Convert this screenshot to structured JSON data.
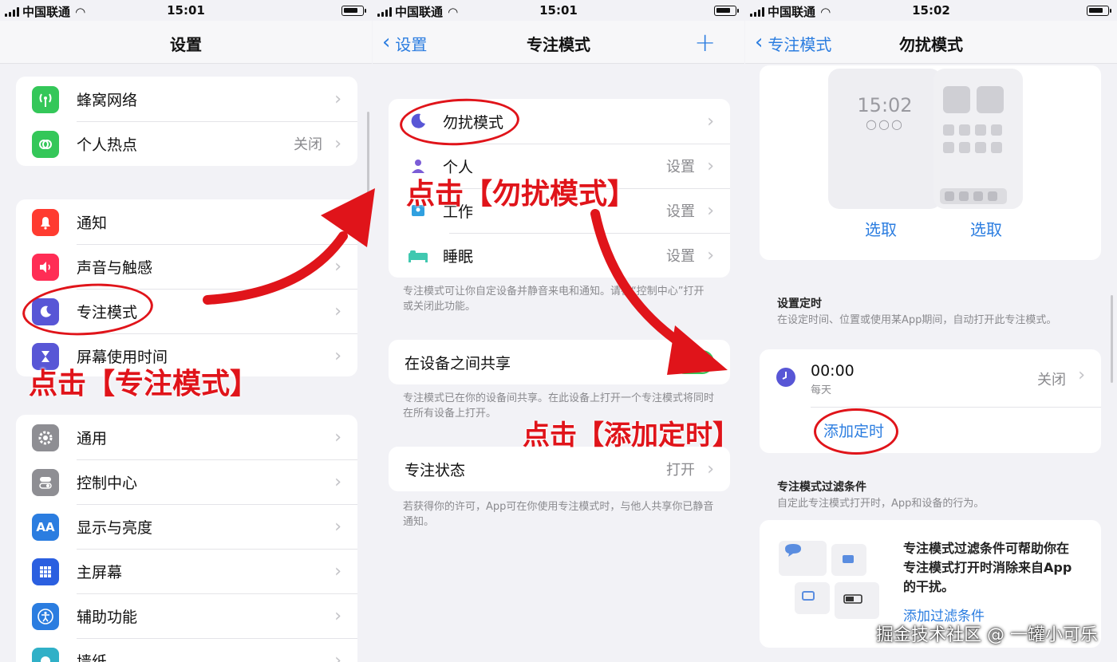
{
  "status_bars": [
    {
      "carrier": "中国联通",
      "time": "15:01"
    },
    {
      "carrier": "中国联通",
      "time": "15:01"
    },
    {
      "carrier": "中国联通",
      "time": "15:02"
    }
  ],
  "screen1": {
    "title": "设置",
    "group1": [
      {
        "label": "蜂窝网络",
        "value": "",
        "icon": "antenna-icon",
        "color": "#34c759"
      },
      {
        "label": "个人热点",
        "value": "关闭",
        "icon": "hotspot-icon",
        "color": "#34c759"
      }
    ],
    "group2": [
      {
        "label": "通知",
        "icon": "bell-icon",
        "color": "#ff3b30"
      },
      {
        "label": "声音与触感",
        "icon": "speaker-icon",
        "color": "#ff2d55"
      },
      {
        "label": "专注模式",
        "icon": "moon-icon",
        "color": "#5856d6"
      },
      {
        "label": "屏幕使用时间",
        "icon": "hourglass-icon",
        "color": "#5856d6"
      }
    ],
    "group3": [
      {
        "label": "通用",
        "icon": "gear-icon",
        "color": "#8e8e93"
      },
      {
        "label": "控制中心",
        "icon": "toggles-icon",
        "color": "#8e8e93"
      },
      {
        "label": "显示与亮度",
        "icon": "text-size-icon",
        "color": "#2b7de0"
      },
      {
        "label": "主屏幕",
        "icon": "grid-icon",
        "color": "#2b5fe0"
      },
      {
        "label": "辅助功能",
        "icon": "accessibility-icon",
        "color": "#2b7de0"
      },
      {
        "label": "墙纸",
        "icon": "wallpaper-icon",
        "color": "#30b0c7"
      }
    ],
    "annotation": "点击【专注模式】"
  },
  "screen2": {
    "back": "设置",
    "title": "专注模式",
    "plus": "+",
    "modes": [
      {
        "label": "勿扰模式",
        "value": "",
        "icon": "moon-icon",
        "color": "#5856d6"
      },
      {
        "label": "个人",
        "value": "设置",
        "icon": "person-icon",
        "color": "#7b5cd6"
      },
      {
        "label": "工作",
        "value": "设置",
        "icon": "id-badge-icon",
        "color": "#30a0e0"
      },
      {
        "label": "睡眠",
        "value": "设置",
        "icon": "bed-icon",
        "color": "#40c8b0"
      }
    ],
    "modes_footnote": "专注模式可让你自定设备并静音来电和通知。请在“控制中心”打开或关闭此功能。",
    "share_label": "在设备之间共享",
    "share_on": true,
    "share_footnote": "专注模式已在你的设备间共享。在此设备上打开一个专注模式将同时在所有设备上打开。",
    "status_label": "专注状态",
    "status_value": "打开",
    "status_footnote": "若获得你的许可，App可在你使用专注模式时，与他人共享你已静音通知。",
    "annotation_top": "点击【勿扰模式】",
    "annotation_bottom": "点击【添加定时】"
  },
  "screen3": {
    "back": "专注模式",
    "title": "勿扰模式",
    "lock_time": "15:02",
    "pick_left": "选取",
    "pick_right": "选取",
    "schedule_header": "设置定时",
    "schedule_desc": "在设定时间、位置或使用某App期间，自动打开此专注模式。",
    "schedule_time": "00:00",
    "schedule_repeat": "每天",
    "schedule_value": "关闭",
    "add_schedule": "添加定时",
    "filter_header": "专注模式过滤条件",
    "filter_desc": "自定此专注模式打开时，App和设备的行为。",
    "filter_text": "专注模式过滤条件可帮助你在专注模式打开时消除来自App的干扰。",
    "add_filter": "添加过滤条件"
  },
  "watermark": "掘金技术社区 @ 一罐小可乐",
  "accent_color": "#2b7de0",
  "annotation_color": "#e0141a"
}
